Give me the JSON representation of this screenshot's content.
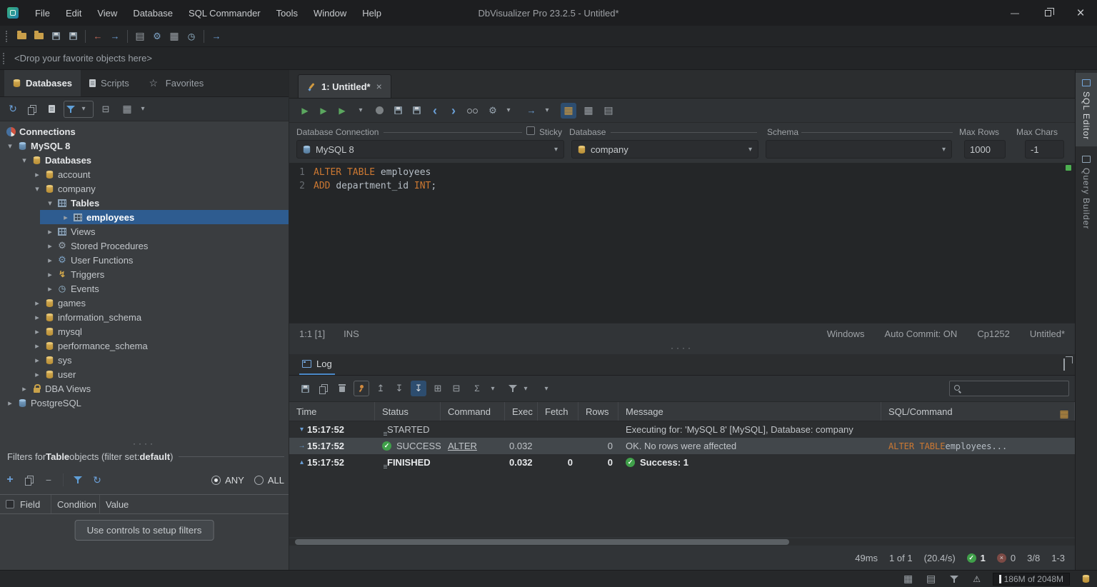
{
  "window": {
    "title": "DbVisualizer Pro 23.2.5 - Untitled*",
    "menu": [
      "File",
      "Edit",
      "View",
      "Database",
      "SQL Commander",
      "Tools",
      "Window",
      "Help"
    ]
  },
  "favorites_bar": "<Drop your favorite objects here>",
  "left": {
    "tabs": [
      {
        "label": "Databases"
      },
      {
        "label": "Scripts"
      },
      {
        "label": "Favorites"
      }
    ],
    "tree": [
      {
        "label": "Connections"
      },
      {
        "label": "MySQL 8"
      },
      {
        "label": "Databases"
      },
      {
        "label": "account"
      },
      {
        "label": "company"
      },
      {
        "label": "Tables"
      },
      {
        "label": "employees"
      },
      {
        "label": "Views"
      },
      {
        "label": "Stored Procedures"
      },
      {
        "label": "User Functions"
      },
      {
        "label": "Triggers"
      },
      {
        "label": "Events"
      },
      {
        "label": "games"
      },
      {
        "label": "information_schema"
      },
      {
        "label": "mysql"
      },
      {
        "label": "performance_schema"
      },
      {
        "label": "sys"
      },
      {
        "label": "user"
      },
      {
        "label": "DBA Views"
      },
      {
        "label": "PostgreSQL"
      }
    ],
    "filter": {
      "title": {
        "pre": "Filters for ",
        "bold": "Table",
        "mid": " objects (filter set: ",
        "set": "default",
        "post": ")"
      },
      "any": "ANY",
      "all": "ALL",
      "cols": {
        "field": "Field",
        "condition": "Condition",
        "value": "Value"
      },
      "setup": "Use controls to setup filters"
    }
  },
  "editor": {
    "tab": "1: Untitled*",
    "form": {
      "connection_label": "Database Connection",
      "connection_value": "MySQL 8",
      "sticky": "Sticky",
      "database_label": "Database",
      "database_value": "company",
      "schema_label": "Schema",
      "max_rows_label": "Max Rows",
      "max_rows_value": "1000",
      "max_chars_label": "Max Chars",
      "max_chars_value": "-1"
    },
    "code": {
      "line1_num": "1",
      "line1_kw": "ALTER TABLE ",
      "line1_id": "employees",
      "line2_num": "2",
      "line2_kw": "ADD ",
      "line2_id": "department_id ",
      "line2_type": "INT",
      "line2_punct": ";"
    },
    "status": {
      "caret": "1:1 [1]",
      "mode": "INS",
      "os": "Windows",
      "autocommit": "Auto Commit: ON",
      "encoding": "Cp1252",
      "file": "Untitled*"
    }
  },
  "log": {
    "tab": "Log",
    "columns": [
      "Time",
      "Status",
      "Command",
      "Exec",
      "Fetch",
      "Rows",
      "Message",
      "SQL/Command"
    ],
    "rows": [
      {
        "time": "15:17:52",
        "status": "STARTED",
        "command": "",
        "exec": "",
        "fetch": "",
        "rows": "",
        "message": "Executing for: 'MySQL 8' [MySQL], Database: company"
      },
      {
        "time": "15:17:52",
        "status": "SUCCESS",
        "command": "ALTER",
        "exec": "0.032",
        "fetch": "",
        "rows": "0",
        "message": "OK. No rows were affected",
        "sql_kw": "ALTER TABLE ",
        "sql_id": "employees..."
      },
      {
        "time": "15:17:52",
        "status": "FINISHED",
        "command": "",
        "exec": "0.032",
        "fetch": "0",
        "rows": "0",
        "message": "Success: 1"
      }
    ],
    "footer": {
      "duration": "49ms",
      "count": "1 of 1",
      "rate": "(20.4/s)",
      "ok": "1",
      "err": "0",
      "page": "3/8",
      "range": "1-3"
    }
  },
  "right_tabs": [
    {
      "label": "SQL Editor"
    },
    {
      "label": "Query Builder"
    }
  ],
  "statusbar": {
    "memory": "186M of 2048M"
  }
}
